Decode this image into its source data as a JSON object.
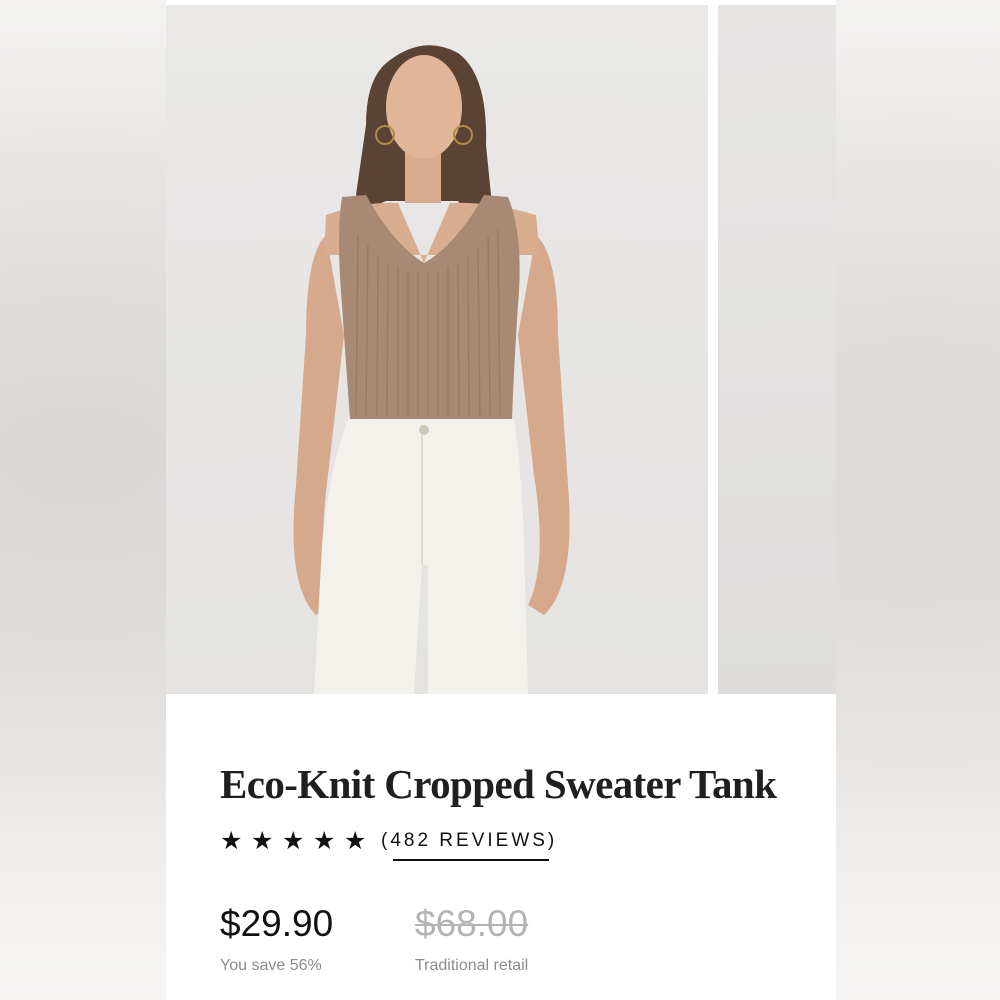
{
  "product": {
    "title": "Eco-Knit Cropped Sweater Tank",
    "rating_stars": 5,
    "reviews_label": "(482 REVIEWS)",
    "price": "$29.90",
    "savings": "You save 56%",
    "retail_price": "$68.00",
    "retail_label": "Traditional retail"
  },
  "colors": {
    "sweater": "#a88a74",
    "jeans": "#f3f1ec",
    "text": "#1f1f1f",
    "muted": "#8c8c8c"
  },
  "icons": {
    "star": "star-icon"
  }
}
